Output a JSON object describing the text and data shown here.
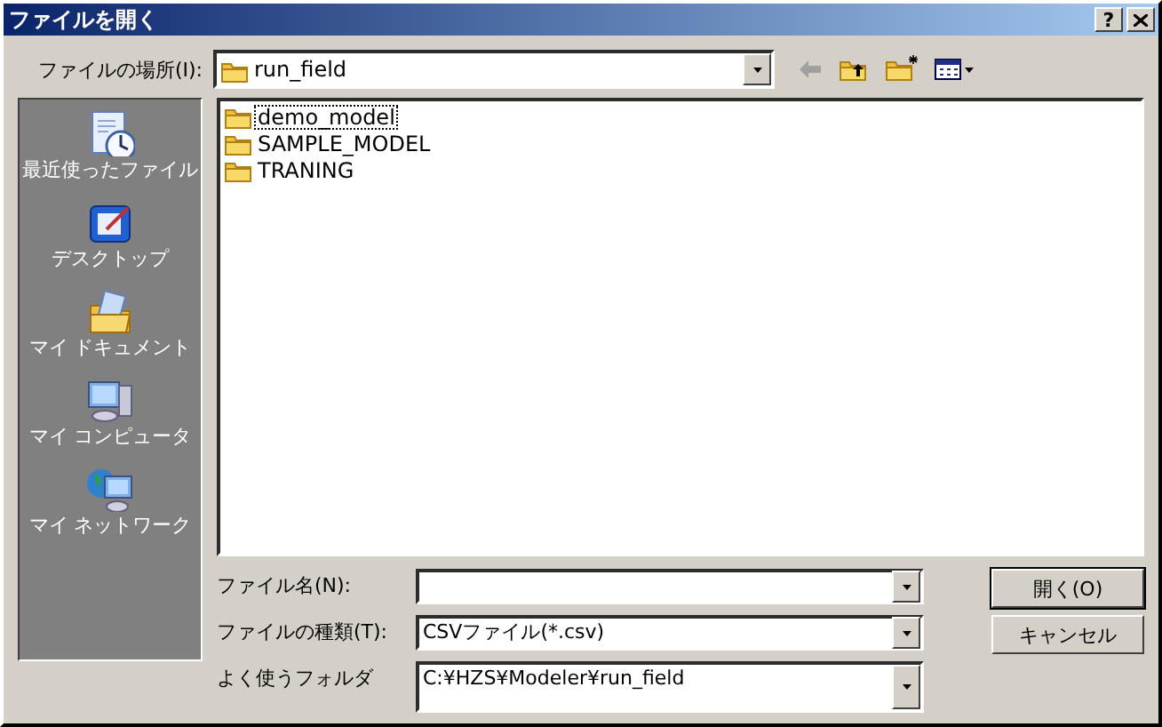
{
  "window": {
    "title": "ファイルを開く",
    "help": "?"
  },
  "look_in": {
    "label": "ファイルの場所(I):",
    "value": "run_field"
  },
  "places": [
    {
      "kind": "recent",
      "label": "最近使ったファイル"
    },
    {
      "kind": "desktop",
      "label": "デスクトップ"
    },
    {
      "kind": "documents",
      "label": "マイ ドキュメント"
    },
    {
      "kind": "computer",
      "label": "マイ コンピュータ"
    },
    {
      "kind": "network",
      "label": "マイ ネットワーク"
    }
  ],
  "files": [
    {
      "name": "demo_model",
      "selected": true
    },
    {
      "name": "SAMPLE_MODEL",
      "selected": false
    },
    {
      "name": "TRANING",
      "selected": false
    }
  ],
  "fields": [
    {
      "kind": "combo",
      "label": "ファイル名(N):"
    },
    {
      "kind": "combo",
      "label": "ファイルの種類(T):",
      "value": "CSVファイル(*.csv)"
    },
    {
      "kind": "multiline",
      "label": "よく使うフォルダ",
      "value": "C:¥HZS¥Modeler¥run_field"
    }
  ],
  "buttons": [
    {
      "label": "開く(O)",
      "default": true
    },
    {
      "label": "キャンセル",
      "default": false
    }
  ]
}
